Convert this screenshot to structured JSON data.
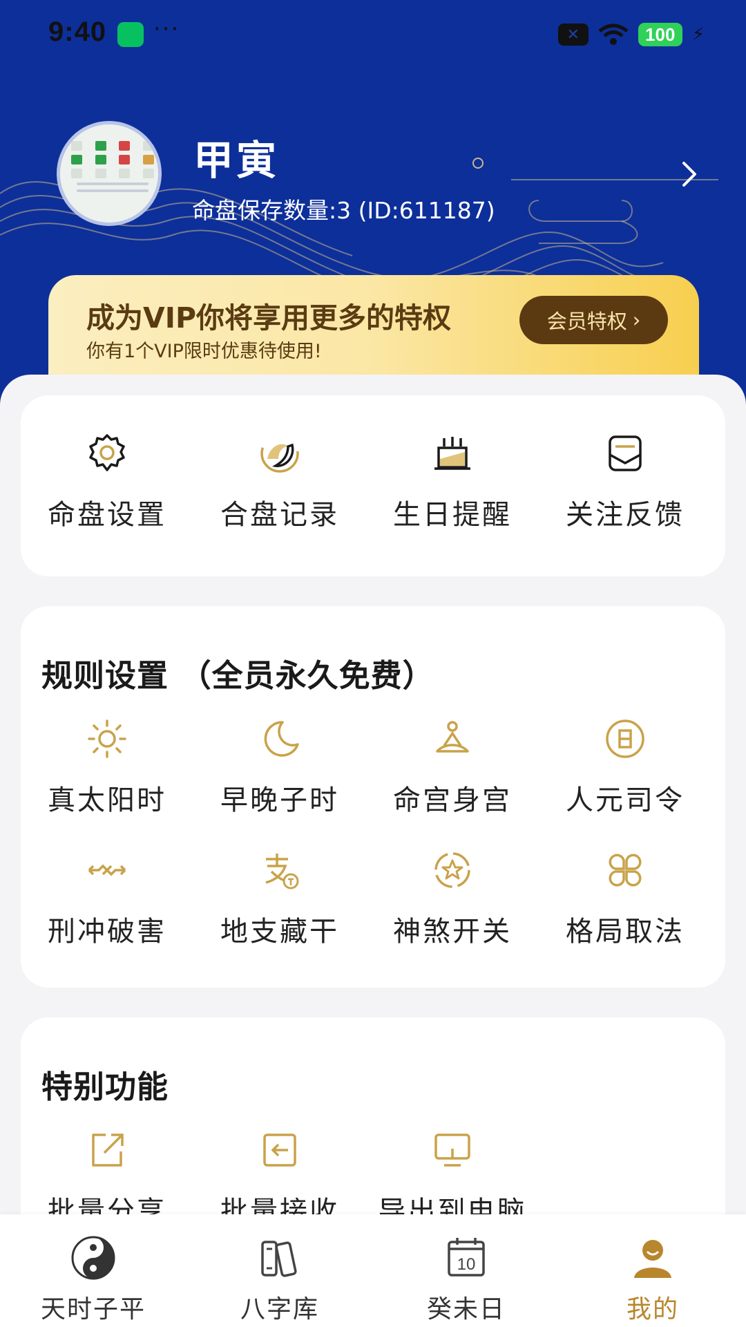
{
  "status": {
    "time": "9:40",
    "dots": "···",
    "battery": "100"
  },
  "profile": {
    "name": "甲寅",
    "meta": "命盘保存数量:3 (ID:611187)"
  },
  "vip": {
    "title": "成为VIP你将享用更多的特权",
    "subtitle": "你有1个VIP限时优惠待使用!",
    "button": "会员特权",
    "button_arrow": "›"
  },
  "quick_actions": [
    {
      "label": "命盘设置",
      "icon": "gear-icon"
    },
    {
      "label": "合盘记录",
      "icon": "fish-icon"
    },
    {
      "label": "生日提醒",
      "icon": "cake-icon"
    },
    {
      "label": "关注反馈",
      "icon": "mail-icon"
    }
  ],
  "rules": {
    "title": "规则设置 （全员永久免费）",
    "items": [
      {
        "label": "真太阳时",
        "icon": "sun-icon"
      },
      {
        "label": "早晚子时",
        "icon": "moon-icon"
      },
      {
        "label": "命宫身宫",
        "icon": "meditation-icon"
      },
      {
        "label": "人元司令",
        "icon": "circle-sun-icon"
      },
      {
        "label": "刑冲破害",
        "icon": "cross-icon"
      },
      {
        "label": "地支藏干",
        "icon": "zhi-char-icon"
      },
      {
        "label": "神煞开关",
        "icon": "star-badge-icon"
      },
      {
        "label": "格局取法",
        "icon": "clover-icon"
      }
    ]
  },
  "special": {
    "title": "特别功能",
    "items": [
      {
        "label": "批量分享",
        "icon": "share-icon"
      },
      {
        "label": "批量接收",
        "icon": "import-icon"
      },
      {
        "label": "导出到电脑",
        "icon": "monitor-icon"
      }
    ]
  },
  "tabs": [
    {
      "label": "天时子平",
      "icon": "yinyang-icon"
    },
    {
      "label": "八字库",
      "icon": "books-icon"
    },
    {
      "label": "癸未日",
      "icon": "calendar-icon",
      "day": "10"
    },
    {
      "label": "我的",
      "icon": "person-icon",
      "active": true
    }
  ],
  "colors": {
    "header_bg": "#0d2f9a",
    "gold": "#c9a24a",
    "vip_text": "#5a3b12",
    "tab_active": "#b8862c"
  }
}
